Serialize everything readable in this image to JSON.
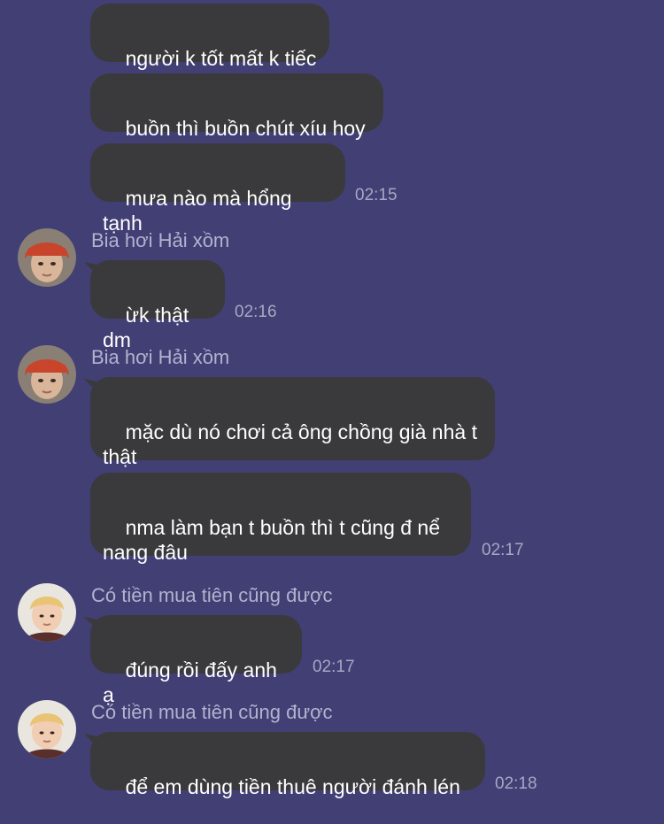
{
  "messages": [
    {
      "text": "người k tốt mất k tiếc"
    },
    {
      "text": "buồn thì buồn chút xíu hoy"
    },
    {
      "text": "mưa nào mà hổng tạnh",
      "time": "02:15"
    },
    {
      "sender": "Bia hơi Hải xồm",
      "text": "ừk thật dm",
      "time": "02:16"
    },
    {
      "sender": "Bia hơi Hải xồm",
      "text": "mặc dù nó chơi cả ông chồng già nhà t thật"
    },
    {
      "text": "nma làm bạn t buồn thì t cũng đ nể nang đâu",
      "time": "02:17"
    },
    {
      "sender": "Có tiền mua tiên cũng được",
      "text": "đúng rồi đấy anh ạ",
      "time": "02:17"
    },
    {
      "sender": "Có tiền mua tiên cũng được",
      "text": "để em dùng tiền thuê người đánh lén",
      "time": "02:18"
    }
  ],
  "colors": {
    "background": "#413f74",
    "bubble": "#3a3a3c",
    "text": "#ffffff",
    "timestamp": "#a8a7c3"
  }
}
